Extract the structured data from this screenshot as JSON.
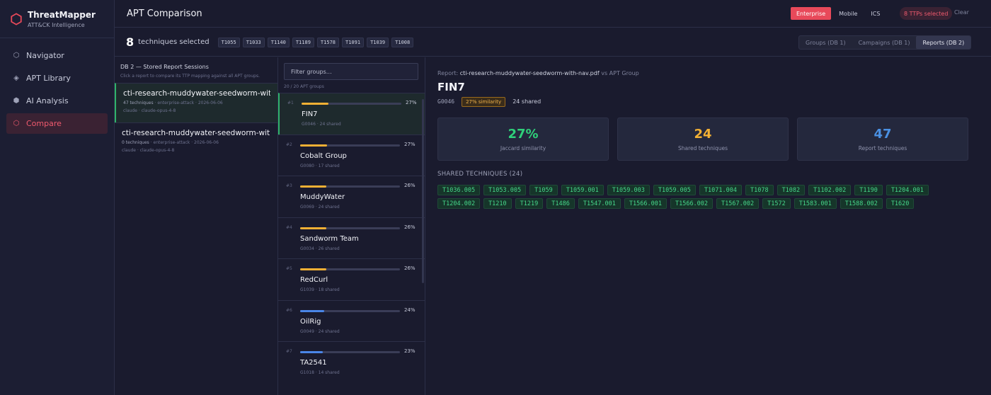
{
  "brand": {
    "title": "ThreatMapper",
    "subtitle": "ATT&CK Intelligence",
    "icon": "hexagon-logo-icon",
    "accent": "#e8495a"
  },
  "nav": [
    {
      "label": "Navigator",
      "icon": "hexagon-outline-icon"
    },
    {
      "label": "APT Library",
      "icon": "diamond-icon"
    },
    {
      "label": "AI Analysis",
      "icon": "hexagon-filled-icon"
    },
    {
      "label": "Compare",
      "icon": "hexagon-outline-icon",
      "active": true
    }
  ],
  "header": {
    "title": "APT Comparison",
    "domains": [
      "Enterprise",
      "Mobile",
      "ICS"
    ],
    "active_domain": "Enterprise",
    "ttp_badge": "8 TTPs selected",
    "clear_label": "Clear"
  },
  "selection": {
    "count": "8",
    "label": "techniques selected",
    "chips": [
      "T1055",
      "T1033",
      "T1140",
      "T1189",
      "T1578",
      "T1091",
      "T1039",
      "T1008"
    ],
    "modes": [
      "Groups (DB 1)",
      "Campaigns (DB 1)",
      "Reports (DB 2)"
    ],
    "active_mode": "Reports (DB 2)"
  },
  "reports_panel": {
    "title": "DB 2 — Stored Report Sessions",
    "subtitle": "Click a report to compare its TTP mapping against all APT groups.",
    "items": [
      {
        "name": "cti-research-muddywater-seedworm-with-nav.pdf",
        "techniques": "47 techniques",
        "domain": "enterprise-attack",
        "date": "2026-06-06",
        "user": "claude",
        "model": "claude-opus-4-8",
        "active": true
      },
      {
        "name": "cti-research-muddywater-seedworm-with-nav.pdf",
        "techniques": "0 techniques",
        "domain": "enterprise-attack",
        "date": "2026-06-06",
        "user": "claude",
        "model": "claude-opus-4-8",
        "active": false
      }
    ]
  },
  "groups_panel": {
    "filter_placeholder": "Filter groups…",
    "count_label": "20 / 20 APT groups",
    "items": [
      {
        "rank": "#1",
        "name": "FIN7",
        "meta": "G0046 · 24 shared",
        "pct_label": "27%",
        "pct": 27,
        "color": "#f2b034",
        "active": true
      },
      {
        "rank": "#2",
        "name": "Cobalt Group",
        "meta": "G0080 · 17 shared",
        "pct_label": "27%",
        "pct": 27,
        "color": "#f2b034"
      },
      {
        "rank": "#3",
        "name": "MuddyWater",
        "meta": "G0069 · 24 shared",
        "pct_label": "26%",
        "pct": 26,
        "color": "#f2b034"
      },
      {
        "rank": "#4",
        "name": "Sandworm Team",
        "meta": "G0034 · 26 shared",
        "pct_label": "26%",
        "pct": 26,
        "color": "#f2b034"
      },
      {
        "rank": "#5",
        "name": "RedCurl",
        "meta": "G1039 · 18 shared",
        "pct_label": "26%",
        "pct": 26,
        "color": "#f2b034"
      },
      {
        "rank": "#6",
        "name": "OilRig",
        "meta": "G0049 · 24 shared",
        "pct_label": "24%",
        "pct": 24,
        "color": "#4a86e8"
      },
      {
        "rank": "#7",
        "name": "TA2541",
        "meta": "G1018 · 14 shared",
        "pct_label": "23%",
        "pct": 23,
        "color": "#4a86e8"
      }
    ]
  },
  "detail": {
    "crumb_prefix": "Report:",
    "crumb_file": "cti-research-muddywater-seedworm-with-nav.pdf",
    "crumb_suffix": "vs APT Group",
    "title": "FIN7",
    "group_id": "G0046",
    "similarity_badge": "27% similarity",
    "shared_text": "24 shared",
    "stats": [
      {
        "value": "27%",
        "label": "Jaccard similarity",
        "color": "#2fd07a"
      },
      {
        "value": "24",
        "label": "Shared techniques",
        "color": "#f2b034"
      },
      {
        "value": "47",
        "label": "Report techniques",
        "color": "#4a90e2"
      }
    ],
    "shared_heading": "SHARED TECHNIQUES (24)",
    "techniques": [
      "T1036.005",
      "T1053.005",
      "T1059",
      "T1059.001",
      "T1059.003",
      "T1059.005",
      "T1071.004",
      "T1078",
      "T1082",
      "T1102.002",
      "T1190",
      "T1204.001",
      "T1204.002",
      "T1210",
      "T1219",
      "T1486",
      "T1547.001",
      "T1566.001",
      "T1566.002",
      "T1567.002",
      "T1572",
      "T1583.001",
      "T1588.002",
      "T1620"
    ]
  }
}
